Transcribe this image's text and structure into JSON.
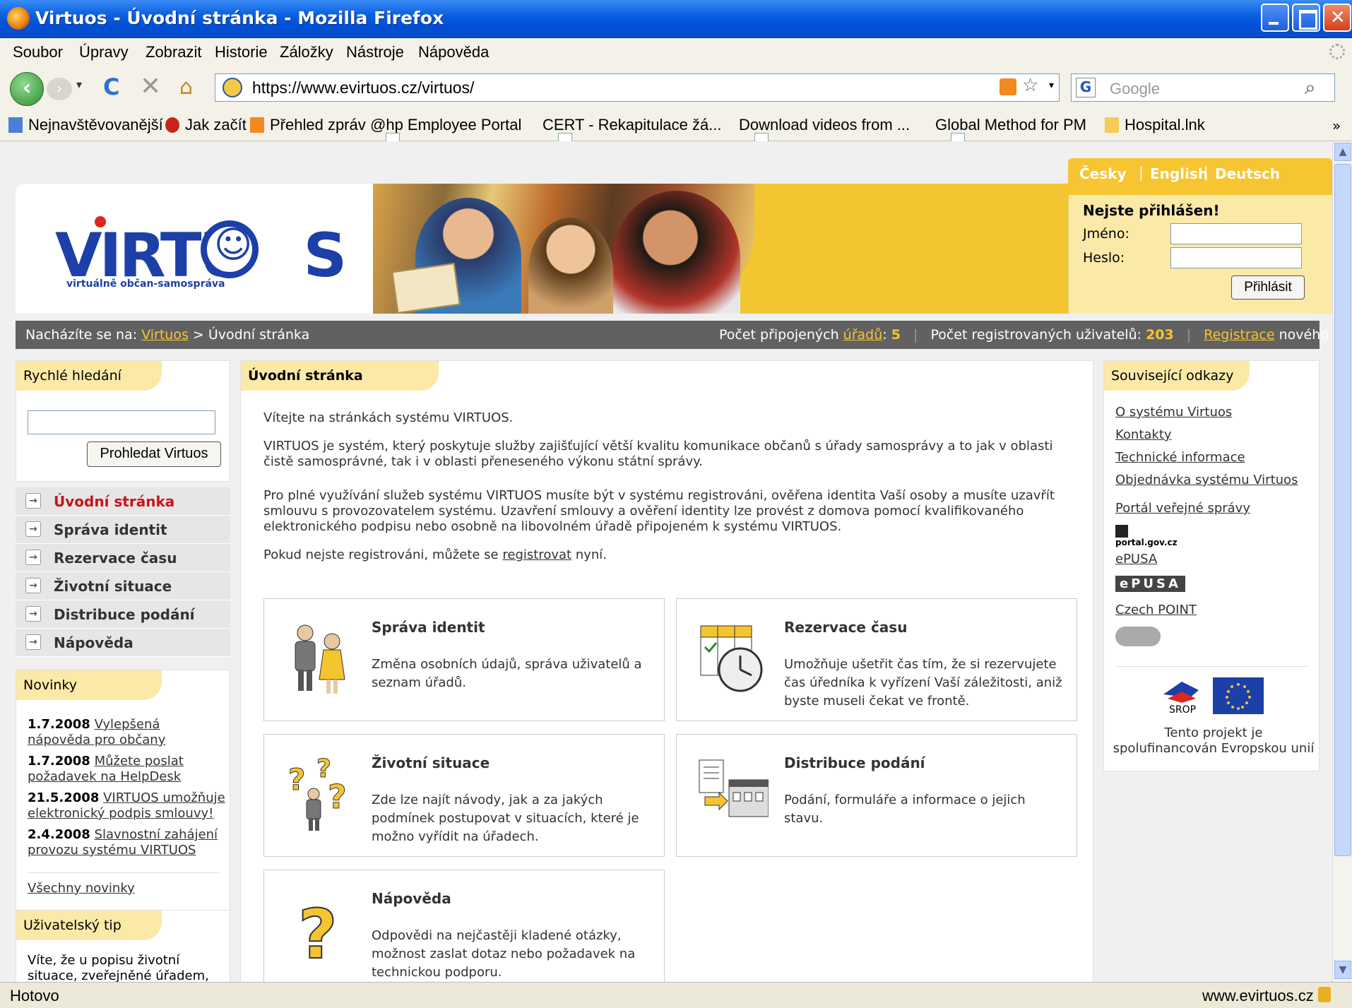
{
  "window": {
    "title": "Virtuos - Úvodní stránka - Mozilla Firefox"
  },
  "menu": [
    "Soubor",
    "Úpravy",
    "Zobrazit",
    "Historie",
    "Záložky",
    "Nástroje",
    "Nápověda"
  ],
  "nav": {
    "url": "https://www.evirtuos.cz/virtuos/",
    "search_placeholder": "Google"
  },
  "bookmarks": [
    "Nejnavštěvovanější",
    "Jak začít",
    "Přehled zpráv",
    "@hp Employee Portal",
    "CERT - Rekapitulace žá...",
    "Download videos from ...",
    "Global Method for PM",
    "Hospital.lnk"
  ],
  "status": {
    "left": "Hotovo",
    "domain": "www.evirtuos.cz"
  },
  "languages": [
    "Česky",
    "English",
    "Deutsch"
  ],
  "logo": {
    "text": "VIRTU",
    "suffix": "S",
    "subtitle": "virtuálně občan-samospráva"
  },
  "login": {
    "title": "Nejste přihlášen!",
    "name_label": "Jméno:",
    "password_label": "Heslo:",
    "button": "Přihlásit"
  },
  "breadcrumb": {
    "prefix": "Nacházíte se na:",
    "root": "Virtuos",
    "sep": ">",
    "current": "Úvodní stránka",
    "offices_label": "Počet připojených",
    "offices_link": "úřadů",
    "offices_count": "5",
    "users_label": "Počet registrovaných uživatelů:",
    "users_count": "203",
    "register_link": "Registrace",
    "register_suffix": "nového uživatele."
  },
  "quick_search": {
    "title": "Rychlé hledání",
    "button": "Prohledat Virtuos"
  },
  "left_menu": [
    {
      "label": "Úvodní stránka",
      "active": true
    },
    {
      "label": "Správa identit"
    },
    {
      "label": "Rezervace času"
    },
    {
      "label": "Životní situace"
    },
    {
      "label": "Distribuce podání"
    },
    {
      "label": "Nápověda"
    }
  ],
  "news": {
    "title": "Novinky",
    "items": [
      {
        "date": "1.7.2008",
        "text": "Vylepšená nápověda pro občany"
      },
      {
        "date": "1.7.2008",
        "text": "Můžete poslat požadavek na HelpDesk"
      },
      {
        "date": "21.5.2008",
        "text": "VIRTUOS umožňuje elektronický podpis smlouvy!"
      },
      {
        "date": "2.4.2008",
        "text": "Slavnostní zahájení provozu systému VIRTUOS"
      }
    ],
    "all": "Všechny novinky"
  },
  "tip": {
    "title": "Uživatelský tip",
    "text": "Víte, že u popisu životní situace, zveřejněné úřadem, se mohou"
  },
  "main": {
    "title": "Úvodní stránka",
    "p1": "Vítejte na stránkách systému VIRTUOS.",
    "p2": "VIRTUOS je systém, který poskytuje služby zajišťující větší kvalitu komunikace občanů s úřady samosprávy a to jak v oblasti čistě samosprávné, tak i v oblasti přeneseného výkonu státní správy.",
    "p3": "Pro plné využívání služeb systému VIRTUOS musíte být v systému registrováni, ověřena identita Vaší osoby a musíte uzavřít smlouvu s provozovatelem systému. Uzavření smlouvy a ověření identity lze provést z domova pomocí kvalifikovaného elektronického podpisu nebo osobně na libovolném úřadě připojeném k systému VIRTUOS.",
    "p4_pre": "Pokud nejste registrováni, můžete se",
    "p4_link": "registrovat",
    "p4_post": "nyní.",
    "cards": [
      {
        "title": "Správa identit",
        "text": "Změna osobních údajů, správa uživatelů a seznam úřadů."
      },
      {
        "title": "Rezervace času",
        "text": "Umožňuje ušetřit čas tím, že si rezervujete čas úředníka k vyřízení Vaší záležitosti, aniž byste museli čekat ve frontě."
      },
      {
        "title": "Životní situace",
        "text": "Zde lze najít návody, jak a za jakých podmínek postupovat v situacích, které je možno vyřídit na úřadech."
      },
      {
        "title": "Distribuce podání",
        "text": "Podání, formuláře a informace o jejich stavu."
      },
      {
        "title": "Nápověda",
        "text": "Odpovědi na nejčastěji kladené otázky, možnost zaslat dotaz nebo požadavek na technickou podporu."
      }
    ]
  },
  "related": {
    "title": "Související odkazy",
    "links": [
      "O systému Virtuos",
      "Kontakty",
      "Technické informace",
      "Objednávka systému Virtuos",
      "Portál veřejné správy",
      "ePUSA",
      "Czech POINT"
    ],
    "portal_logo": "portal.gov.cz",
    "epusa_logo": "ePUSA",
    "eu_text": "Tento projekt je spolufinancován Evropskou unií",
    "srop_logo": "SROP"
  }
}
